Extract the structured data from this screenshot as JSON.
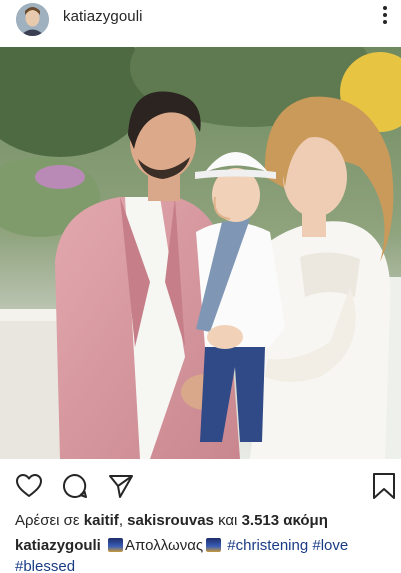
{
  "post": {
    "username": "katiazygouli"
  },
  "likes": {
    "prefix": "Αρέσει σε",
    "user1": "kaitif",
    "separator": ",",
    "user2": "sakisrouvas",
    "connector": "και",
    "count": "3.513 ακόμη"
  },
  "caption": {
    "username": "katiazygouli",
    "location": "Απολλωνας",
    "tags": [
      "#christening",
      "#love",
      "#blessed"
    ]
  },
  "icons": {
    "more": "more-vertical-icon",
    "like": "heart-icon",
    "comment": "comment-icon",
    "share": "send-icon",
    "save": "bookmark-icon",
    "emoji": "night-cityscape-emoji"
  },
  "colors": {
    "text": "#262626",
    "hashtag": "#1a3c85",
    "suit": "#d79aa0"
  }
}
